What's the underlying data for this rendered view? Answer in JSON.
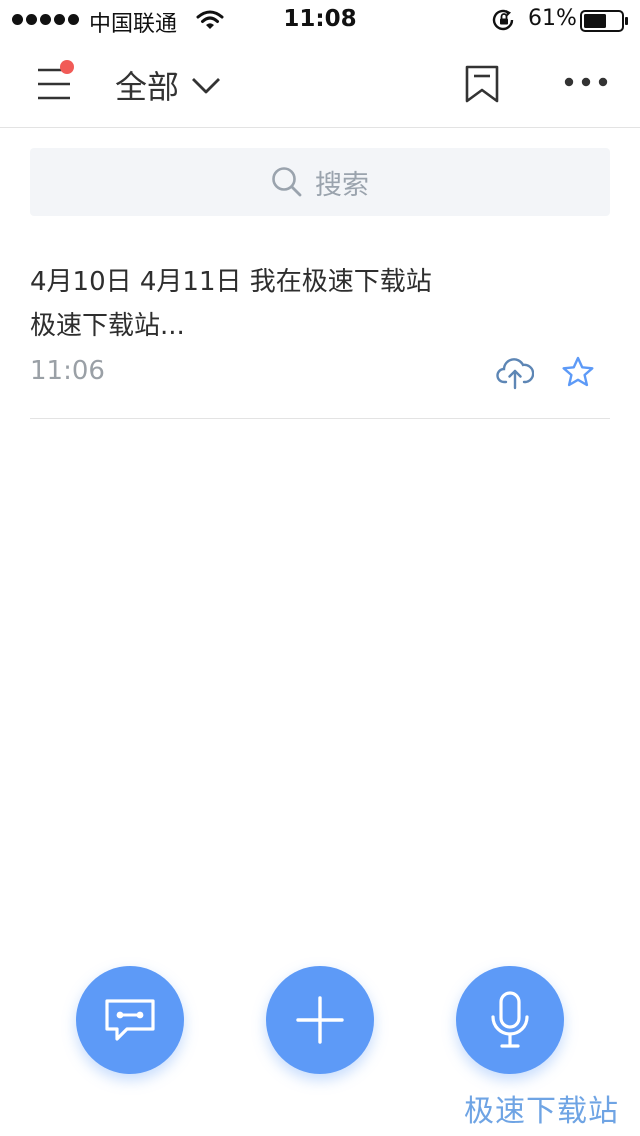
{
  "status_bar": {
    "carrier": "中国联通",
    "time": "11:08",
    "battery_percent": "61%",
    "battery_level": 0.61
  },
  "nav": {
    "filter_label": "全部",
    "has_notification": true
  },
  "search": {
    "placeholder": "搜索"
  },
  "notes": [
    {
      "preview_line1": "4月10日 4月11日 我在极速下载站",
      "preview_line2": "极速下载站...",
      "time": "11:06",
      "starred": false
    }
  ],
  "fab": {
    "icons": [
      "message-icon",
      "plus-icon",
      "microphone-icon"
    ]
  },
  "watermark": "极速下载站",
  "colors": {
    "accent": "#5d9af7",
    "notification_dot": "#f15b57",
    "search_bg": "#f3f5f8",
    "watermark": "#6fa4e4"
  }
}
